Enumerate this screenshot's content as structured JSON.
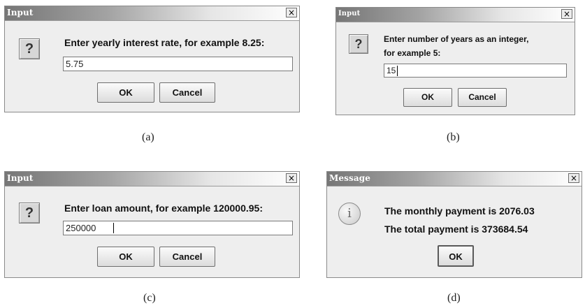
{
  "dialogs": {
    "a": {
      "title": "Input",
      "close": "×",
      "prompt": "Enter yearly interest rate, for example 8.25:",
      "value": "5.75",
      "ok": "OK",
      "cancel": "Cancel",
      "caption": "(a)"
    },
    "b": {
      "title": "Input",
      "close": "×",
      "prompt_line1": "Enter number of years as an integer,",
      "prompt_line2": "for example 5:",
      "value": "15",
      "ok": "OK",
      "cancel": "Cancel",
      "caption": "(b)"
    },
    "c": {
      "title": "Input",
      "close": "×",
      "prompt": "Enter loan amount, for example 120000.95:",
      "value": "250000",
      "ok": "OK",
      "cancel": "Cancel",
      "caption": "(c)"
    },
    "d": {
      "title": "Message",
      "close": "×",
      "line1": "The monthly payment is 2076.03",
      "line2": "The total payment is 373684.54",
      "ok": "OK",
      "caption": "(d)"
    }
  },
  "icons": {
    "question": "?",
    "info": "i"
  }
}
